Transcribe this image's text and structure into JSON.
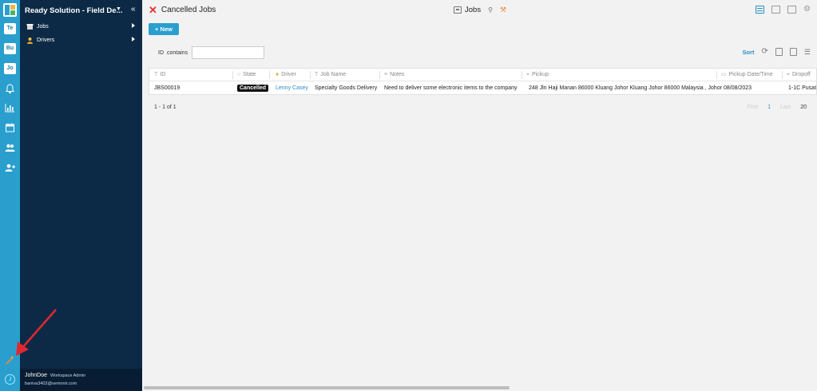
{
  "rail": {
    "workspaces": [
      "Te",
      "Bu",
      "Jo"
    ],
    "icons": [
      "bell-icon",
      "bar-chart-icon",
      "calendar-icon",
      "users-icon",
      "user-plus-icon",
      "magic-wand-icon"
    ],
    "avatar": "J"
  },
  "sidebar": {
    "title": "Ready Solution - Field De...",
    "items": [
      {
        "label": "Jobs",
        "icon": "box-icon"
      },
      {
        "label": "Drivers",
        "icon": "person-icon"
      }
    ],
    "user": {
      "name": "JohnDoe",
      "role": "Workspace Admin",
      "email": "baniva3403@semonir.com"
    }
  },
  "header": {
    "title": "Cancelled Jobs",
    "center_label": "Jobs"
  },
  "toolbar": {
    "new_label": "New",
    "new_prefix": "+",
    "filter_field": "ID",
    "filter_op": "contains",
    "sort_label": "Sort"
  },
  "table": {
    "columns": [
      "ID",
      "State",
      "Driver",
      "Job Name",
      "Notes",
      "Pickup",
      "Pickup Date/Time",
      "Dropoff"
    ],
    "rows": [
      {
        "id": "JBS00019",
        "state": "Cancelled",
        "driver": "Lenny Casey",
        "job_name": "Specialty Goods Delivery",
        "notes": "Need to deliver some electronic items to the company",
        "pickup": "248 Jln Haji Manan 86000 Kluang Johor Kluang Johor 86000 Malaysia , Johor",
        "pickup_datetime": "08/08/2023",
        "dropoff": "1-1C Pusat"
      }
    ]
  },
  "pager": {
    "summary": "1 - 1 of 1",
    "first": "First",
    "page": "1",
    "last": "Last",
    "page_size": "20"
  },
  "colors": {
    "rail": "#2a9fce",
    "sidebar": "#0c2a46",
    "accent": "#2a8fc4",
    "cancel": "#e5322d"
  }
}
